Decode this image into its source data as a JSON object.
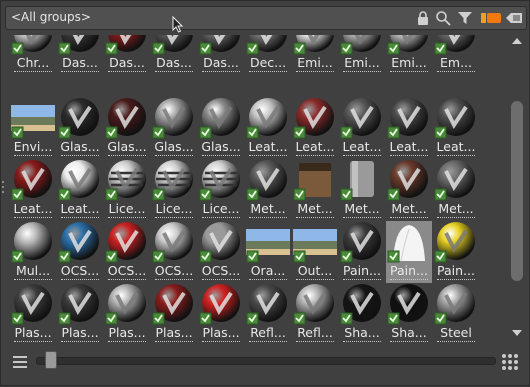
{
  "toolbar": {
    "group_value": "<All groups>",
    "icons": [
      "lock-icon",
      "search-icon",
      "filter-icon",
      "view-toggle-icon",
      "tag-icon"
    ]
  },
  "colors": {
    "accent": "#f0a020",
    "check": "#5cb85c",
    "panel": "#404040"
  },
  "items": [
    {
      "label": "Chr...",
      "ball": "#d4d4d4",
      "mat": "chrome"
    },
    {
      "label": "Das...",
      "ball": "#3a3a3a",
      "mat": "dark"
    },
    {
      "label": "Das...",
      "ball": "#8a1c1c",
      "mat": "dark"
    },
    {
      "label": "Das...",
      "ball": "#5a5a5a",
      "mat": "dark"
    },
    {
      "label": "Das...",
      "ball": "#6a6a6a",
      "mat": "dark"
    },
    {
      "label": "Dec...",
      "ball": "#7a7a7a",
      "mat": "dark"
    },
    {
      "label": "Emi...",
      "ball": "#f4f4f4",
      "mat": "light"
    },
    {
      "label": "Emi...",
      "ball": "#bababa",
      "mat": "light"
    },
    {
      "label": "Emi...",
      "ball": "#c8c8c8",
      "mat": "light"
    },
    {
      "label": "Em...",
      "ball": "#6e6e6e",
      "mat": "dark"
    },
    {
      "label": "Envi...",
      "ball": "#6aa3d8",
      "mat": "env"
    },
    {
      "label": "Glas...",
      "ball": "#2c2c2c",
      "mat": "dark"
    },
    {
      "label": "Glas...",
      "ball": "#4a1a1a",
      "mat": "dark"
    },
    {
      "label": "Glas...",
      "ball": "#a0a0a0",
      "mat": "light"
    },
    {
      "label": "Glas...",
      "ball": "#8a8a8a",
      "mat": "light"
    },
    {
      "label": "Leat...",
      "ball": "#c2c2c2",
      "mat": "light"
    },
    {
      "label": "Leat...",
      "ball": "#8b2a2a",
      "mat": "dark"
    },
    {
      "label": "Leat...",
      "ball": "#555555",
      "mat": "dark"
    },
    {
      "label": "Leat...",
      "ball": "#4a4a4a",
      "mat": "dark"
    },
    {
      "label": "Leat...",
      "ball": "#4e4e4e",
      "mat": "dark"
    },
    {
      "label": "Leat...",
      "ball": "#8a1a1a",
      "mat": "dark"
    },
    {
      "label": "Leat...",
      "ball": "#ececec",
      "mat": "light"
    },
    {
      "label": "Lice...",
      "ball": "#cfcfcf",
      "mat": "zebra"
    },
    {
      "label": "Lice...",
      "ball": "#cfcfcf",
      "mat": "zebra"
    },
    {
      "label": "Lice...",
      "ball": "#cfcfcf",
      "mat": "zebra"
    },
    {
      "label": "Met...",
      "ball": "#5a5a5a",
      "mat": "dark"
    },
    {
      "label": "Met...",
      "ball": "#7a5a3a",
      "mat": "cube"
    },
    {
      "label": "Met...",
      "ball": "#9a9a9a",
      "mat": "cyl"
    },
    {
      "label": "Met...",
      "ball": "#6a3a2a",
      "mat": "dark"
    },
    {
      "label": "Met...",
      "ball": "#6a6a6a",
      "mat": "dark"
    },
    {
      "label": "Mul...",
      "ball": "#b8b8b8",
      "mat": "plain"
    },
    {
      "label": "OCS...",
      "ball": "#2a6fa8",
      "mat": "dark"
    },
    {
      "label": "OCS...",
      "ball": "#cc2020",
      "mat": "dark"
    },
    {
      "label": "OCS...",
      "ball": "#c9c9c9",
      "mat": "light"
    },
    {
      "label": "OCS...",
      "ball": "#9a9a9a",
      "mat": "dark"
    },
    {
      "label": "Ora...",
      "ball": "#6aa3d8",
      "mat": "env"
    },
    {
      "label": "Out...",
      "ball": "#6aa3d8",
      "mat": "env"
    },
    {
      "label": "Pain...",
      "ball": "#3a3a3a",
      "mat": "dark"
    },
    {
      "label": "Pain...",
      "ball": "#e8e8e8",
      "mat": "cloth"
    },
    {
      "label": "Pain...",
      "ball": "#e6d020",
      "mat": "light"
    },
    {
      "label": "Plas...",
      "ball": "#3c3c3c",
      "mat": "dark"
    },
    {
      "label": "Plas...",
      "ball": "#3a3a3a",
      "mat": "dark"
    },
    {
      "label": "Plas...",
      "ball": "#b0b0b0",
      "mat": "light"
    },
    {
      "label": "Plas...",
      "ball": "#8a1c1c",
      "mat": "dark"
    },
    {
      "label": "Plas...",
      "ball": "#d02020",
      "mat": "dark"
    },
    {
      "label": "Refl...",
      "ball": "#4a4a4a",
      "mat": "dark"
    },
    {
      "label": "Refl...",
      "ball": "#b0b0b0",
      "mat": "light"
    },
    {
      "label": "Sha...",
      "ball": "#151515",
      "mat": "dark"
    },
    {
      "label": "Sha...",
      "ball": "#101010",
      "mat": "dark"
    },
    {
      "label": "Steel",
      "ball": "#a0a0a0",
      "mat": "chrome"
    }
  ],
  "selected_index": 38
}
